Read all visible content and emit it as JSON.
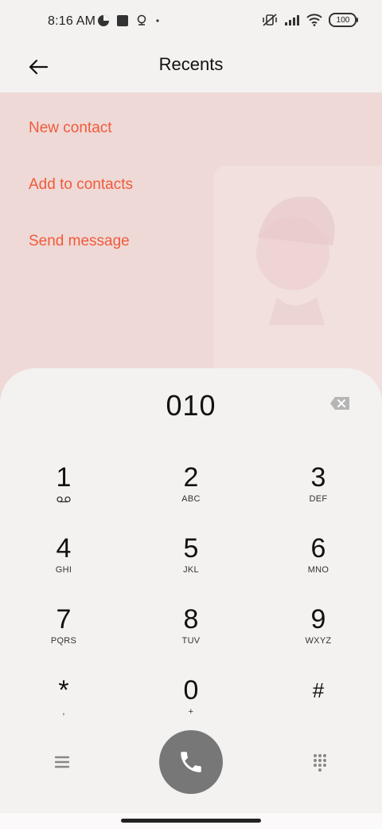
{
  "status_bar": {
    "time": "8:16 AM",
    "battery": "100",
    "left_icons": [
      "data-saver-icon",
      "square-notification-icon",
      "location-icon",
      "dot-icon"
    ],
    "right_icons": [
      "muted-vibrate-icon",
      "signal-icon",
      "wifi-icon",
      "battery-icon"
    ]
  },
  "app_bar": {
    "title": "Recents",
    "back_icon": "back-arrow-icon"
  },
  "options": {
    "new_contact": "New contact",
    "add_to_contacts": "Add to contacts",
    "send_message": "Send message"
  },
  "dialer": {
    "number": "010",
    "backspace_icon": "backspace-icon",
    "keys": [
      {
        "digit": "1",
        "letters": ""
      },
      {
        "digit": "2",
        "letters": "ABC"
      },
      {
        "digit": "3",
        "letters": "DEF"
      },
      {
        "digit": "4",
        "letters": "GHI"
      },
      {
        "digit": "5",
        "letters": "JKL"
      },
      {
        "digit": "6",
        "letters": "MNO"
      },
      {
        "digit": "7",
        "letters": "PQRS"
      },
      {
        "digit": "8",
        "letters": "TUV"
      },
      {
        "digit": "9",
        "letters": "WXYZ"
      },
      {
        "digit": "*",
        "letters": ","
      },
      {
        "digit": "0",
        "letters": "+"
      },
      {
        "digit": "#",
        "letters": ""
      }
    ],
    "key1_icon": "voicemail-icon",
    "menu_icon": "menu-icon",
    "call_icon": "phone-icon",
    "dialpad_icon": "dialpad-icon"
  },
  "colors": {
    "accent": "#f05a3a",
    "options_bg": "#eed9d7",
    "call_button": "#777777"
  }
}
